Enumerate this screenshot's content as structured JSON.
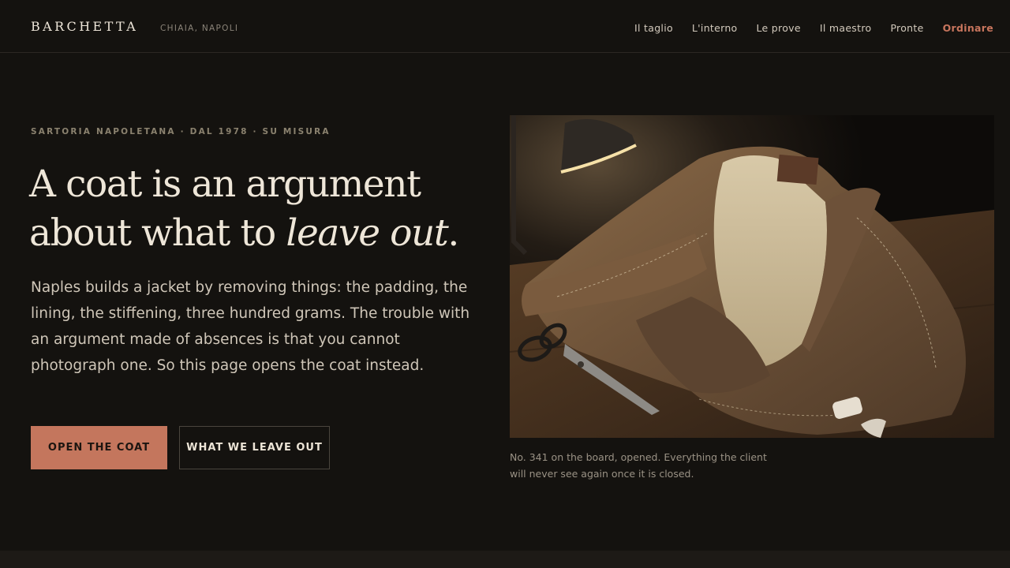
{
  "header": {
    "brand": "BARCHETTA",
    "location": "CHIAIA, NAPOLI",
    "nav": [
      "Il taglio",
      "L'interno",
      "Le prove",
      "Il maestro",
      "Pronte"
    ],
    "order_label": "Ordinare"
  },
  "hero": {
    "eyebrow": "SARTORIA NAPOLETANA · DAL 1978 · SU MISURA",
    "headline_line1": "A coat is an argument",
    "headline_line2_start": "about what to ",
    "headline_line2_em": "leave out",
    "headline_line2_end": ".",
    "lede": "Naples builds a jacket by removing things: the padding, the lining, the stiffening, three hundred grams. The trouble with an argument made of absences is that you cannot photograph one. So this page opens the coat instead.",
    "primary_cta": "OPEN THE COAT",
    "secondary_cta": "WHAT WE LEAVE OUT"
  },
  "photo": {
    "caption": "No. 341 on the board, opened. Everything the client will never see again once it is closed."
  },
  "colors": {
    "background": "#14120f",
    "accent": "#c4765d",
    "text": "#eee6d8"
  }
}
